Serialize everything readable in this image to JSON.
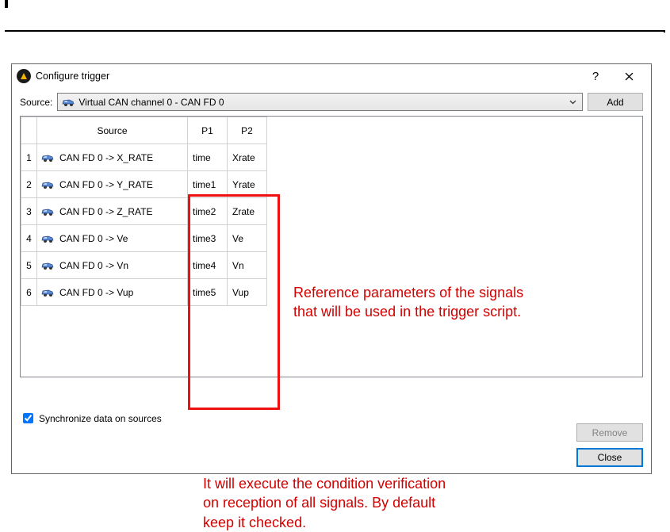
{
  "window": {
    "title": "Configure trigger"
  },
  "source_row": {
    "label": "Source:",
    "selected": "Virtual CAN channel 0 - CAN FD 0",
    "add_label": "Add"
  },
  "table": {
    "headers": {
      "source": "Source",
      "p1": "P1",
      "p2": "P2"
    },
    "rows": [
      {
        "n": "1",
        "src": "CAN FD 0 -> X_RATE",
        "p1": "time",
        "p2": "Xrate"
      },
      {
        "n": "2",
        "src": "CAN FD 0 -> Y_RATE",
        "p1": "time1",
        "p2": "Yrate"
      },
      {
        "n": "3",
        "src": "CAN FD 0 -> Z_RATE",
        "p1": "time2",
        "p2": "Zrate"
      },
      {
        "n": "4",
        "src": "CAN FD 0 -> Ve",
        "p1": "time3",
        "p2": "Ve"
      },
      {
        "n": "5",
        "src": "CAN FD 0 -> Vn",
        "p1": "time4",
        "p2": "Vn"
      },
      {
        "n": "6",
        "src": "CAN FD 0 -> Vup",
        "p1": "time5",
        "p2": "Vup"
      }
    ]
  },
  "sync": {
    "checked": true,
    "label": "Synchronize data on sources"
  },
  "buttons": {
    "remove": "Remove",
    "close": "Close"
  },
  "annotations": {
    "a1_line1": "Reference parameters of the signals",
    "a1_line2": "that will be used in the trigger script.",
    "a2_line1": "It will execute the condition verification",
    "a2_line2": "on reception of all signals. By default",
    "a2_line3": "keep it checked."
  }
}
